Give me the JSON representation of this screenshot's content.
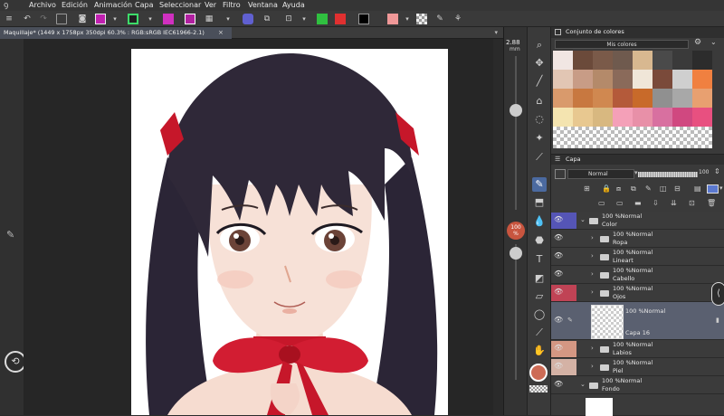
{
  "menubar": {
    "items": [
      "Archivo",
      "Edición",
      "Animación",
      "Capa",
      "Seleccionar",
      "Ver",
      "Filtro",
      "Ventana",
      "Ayuda"
    ]
  },
  "document": {
    "tab_title": "Maquillaje* (1449 x 1758px 350dpi 60.3% : RGB:sRGB IEC61966-2.1)",
    "close_glyph": "×",
    "chevron_glyph": "▾"
  },
  "brush_size": {
    "value": "2.88",
    "unit": "mm",
    "level": 0.35
  },
  "opacity": {
    "value": "100",
    "unit": "%",
    "level": 1.0
  },
  "color_set_panel": {
    "title": "Conjunto de colores",
    "set_name": "Mis colores",
    "swatches": [
      "#f1e6e3",
      "#6b4a3a",
      "#7a5a49",
      "#6f5a4e",
      "#d8b890",
      "#4a4a4a",
      "#3a3a3a",
      "#2c2c2c",
      "#e2c6b4",
      "#c89c86",
      "#b48a6a",
      "#8a6a5a",
      "#f0e6d8",
      "#7a4a3a",
      "#cfcfcf",
      "#f08040",
      "#d99a6c",
      "#c87840",
      "#d08850",
      "#b45a3a",
      "#c86a2a",
      "#909090",
      "#a8a8a8",
      "#e8a070",
      "#f4e4b0",
      "#e8c890",
      "#d8b880",
      "#f4a0b8",
      "#e890a8",
      "#d870a0",
      "#d04880",
      "#e85080"
    ]
  },
  "layer_panel": {
    "title": "Capa",
    "blend_mode": "Normal",
    "opacity_value": "100",
    "layers": [
      {
        "mode": "100 %Normal",
        "name": "Color",
        "kind": "folder",
        "level": 0,
        "tag_color": "#5a5acc"
      },
      {
        "mode": "100 %Normal",
        "name": "Ropa",
        "kind": "folder",
        "level": 1,
        "tag_color": ""
      },
      {
        "mode": "100 %Normal",
        "name": "Lineart",
        "kind": "folder",
        "level": 1,
        "tag_color": ""
      },
      {
        "mode": "100 %Normal",
        "name": "Cabello",
        "kind": "folder",
        "level": 1,
        "tag_color": ""
      },
      {
        "mode": "100 %Normal",
        "name": "Ojos",
        "kind": "folder",
        "level": 1,
        "tag_color": "#d8455a"
      },
      {
        "mode": "100 %Normal",
        "name": "Capa 16",
        "kind": "raster",
        "level": 1,
        "tag_color": "",
        "selected": true
      },
      {
        "mode": "100 %Normal",
        "name": "Labios",
        "kind": "folder",
        "level": 1,
        "tag_color": "#f0a890"
      },
      {
        "mode": "100 %Normal",
        "name": "Piel",
        "kind": "folder",
        "level": 1,
        "tag_color": "#f0c8b8"
      },
      {
        "mode": "100 %Normal",
        "name": "Fondo",
        "kind": "folder",
        "level": 0,
        "tag_color": ""
      }
    ]
  },
  "colors": {
    "main_color": "#cd6b55",
    "sub_color": "#ffffff",
    "toolbar_main": "#000000",
    "toolbar_sub": "#f09898",
    "accent_select": "#4b6aa0"
  }
}
